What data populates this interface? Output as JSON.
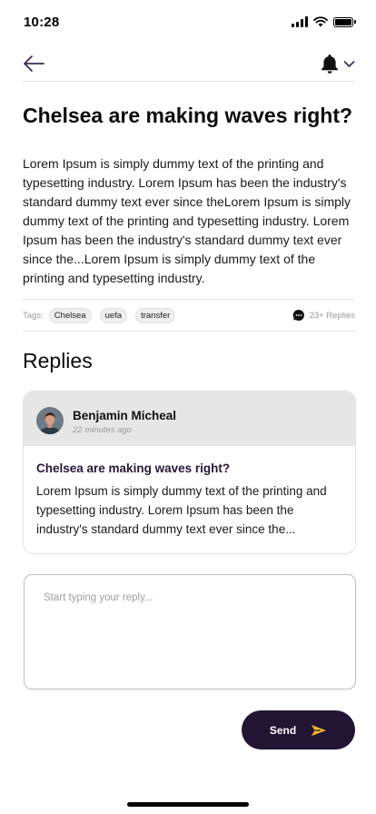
{
  "status_bar": {
    "time": "10:28",
    "icons": [
      "signal-icon",
      "wifi-icon",
      "battery-icon"
    ]
  },
  "nav": {
    "back_icon": "arrow-left-icon",
    "bell_icon": "bell-icon",
    "dropdown_icon": "chevron-down-icon",
    "accent_color": "#2a1538"
  },
  "post": {
    "title": "Chelsea are making waves right?",
    "body": "Lorem Ipsum is simply dummy text of the printing and typesetting industry. Lorem Ipsum has been the industry's standard dummy text ever since theLorem Ipsum is simply dummy text of the printing and typesetting industry. Lorem Ipsum has been the industry's standard dummy text ever since the...Lorem Ipsum is simply dummy text of the printing and typesetting industry.",
    "tags_label": "Tags:",
    "tags": [
      "Chelsea",
      "uefa",
      "transfer"
    ],
    "replies_count": "23+ Replies",
    "replies_icon": "chat-bubble-icon"
  },
  "replies": {
    "heading": "Replies",
    "items": [
      {
        "author": "Benjamin Micheal",
        "time": "22 minutes ago",
        "title": "Chelsea are making waves right?",
        "body": "Lorem Ipsum is simply dummy text of the printing and typesetting industry. Lorem Ipsum has been the industry's standard dummy text ever since the..."
      }
    ]
  },
  "reply_form": {
    "placeholder": "Start typing your reply...",
    "value": "",
    "send_label": "Send",
    "send_icon": "send-arrow-icon",
    "send_icon_color": "#f5b82e",
    "button_color": "#221433"
  }
}
